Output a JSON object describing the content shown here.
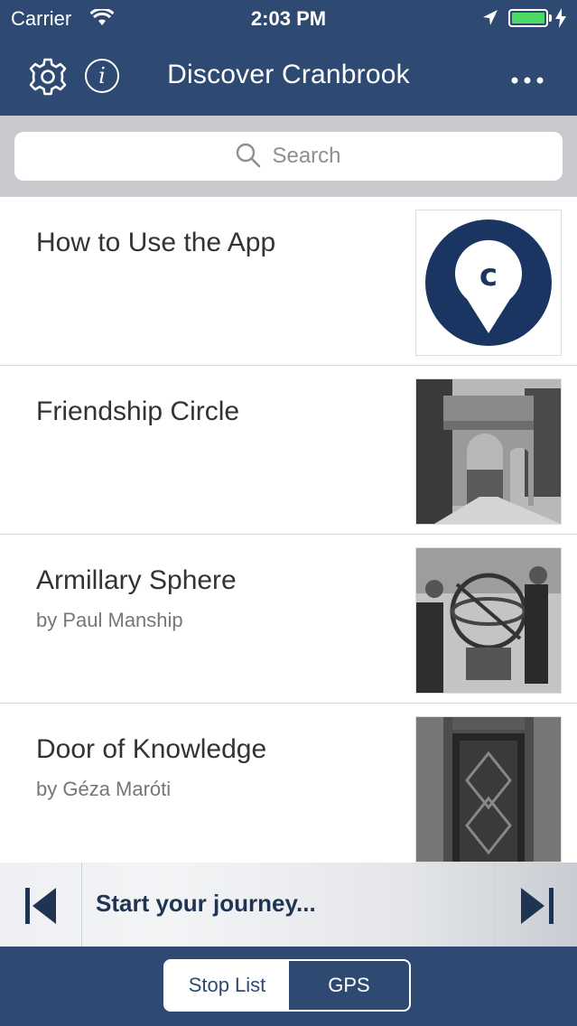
{
  "status_bar": {
    "carrier": "Carrier",
    "time": "2:03 PM"
  },
  "nav": {
    "title": "Discover Cranbrook",
    "info_glyph": "i"
  },
  "search": {
    "placeholder": "Search"
  },
  "stops": [
    {
      "name": "How to Use the App",
      "subtitle": "",
      "thumb": "cranbrook-logo"
    },
    {
      "name": "Friendship Circle",
      "subtitle": "",
      "thumb": "arch-photo"
    },
    {
      "name": "Armillary Sphere",
      "subtitle": "by Paul Manship",
      "thumb": "sphere-photo"
    },
    {
      "name": "Door of Knowledge",
      "subtitle": "by Géza Maróti",
      "thumb": "door-photo"
    }
  ],
  "player": {
    "label": "Start your journey..."
  },
  "segmented": {
    "options": [
      "Stop List",
      "GPS"
    ],
    "selected": "Stop List"
  },
  "colors": {
    "brand": "#2e4a72",
    "logo": "#1b3563",
    "battery": "#4cd964"
  },
  "logo_letter": "c"
}
